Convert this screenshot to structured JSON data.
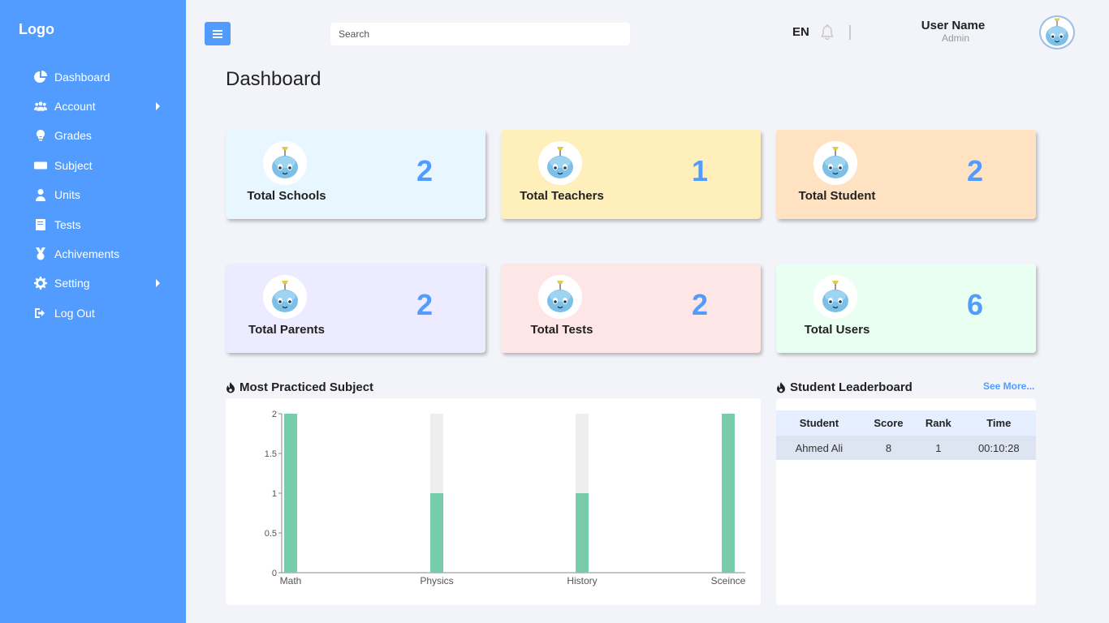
{
  "sidebar": {
    "logo": "Logo",
    "items": [
      {
        "label": "Dashboard",
        "icon": "pie-chart-icon"
      },
      {
        "label": "Account",
        "icon": "users-icon",
        "has_submenu": true
      },
      {
        "label": "Grades",
        "icon": "lightbulb-icon"
      },
      {
        "label": "Subject",
        "icon": "keyboard-icon"
      },
      {
        "label": "Units",
        "icon": "user-icon"
      },
      {
        "label": "Tests",
        "icon": "book-icon"
      },
      {
        "label": "Achivements",
        "icon": "medal-icon"
      },
      {
        "label": "Setting",
        "icon": "gear-icon",
        "has_submenu": true
      },
      {
        "label": "Log Out",
        "icon": "logout-icon"
      }
    ]
  },
  "header": {
    "search_placeholder": "Search",
    "language": "EN",
    "user_name": "User Name",
    "user_role": "Admin"
  },
  "page": {
    "title": "Dashboard"
  },
  "stats": [
    {
      "label": "Total Schools",
      "value": "2",
      "bg": "#e8f7ff"
    },
    {
      "label": "Total Teachers",
      "value": "1",
      "bg": "#ffefbb"
    },
    {
      "label": "Total Student",
      "value": "2",
      "bg": "#ffe2c1"
    },
    {
      "label": "Total Parents",
      "value": "2",
      "bg": "#ecebff"
    },
    {
      "label": "Total Tests",
      "value": "2",
      "bg": "#ffe6e6"
    },
    {
      "label": "Total Users",
      "value": "6",
      "bg": "#e9fff1"
    }
  ],
  "sections": {
    "chart_title": "Most Practiced Subject",
    "leaderboard_title": "Student Leaderboard",
    "see_more": "See More..."
  },
  "leaderboard": {
    "columns": [
      "Student",
      "Score",
      "Rank",
      "Time"
    ],
    "rows": [
      [
        "Ahmed Ali",
        "8",
        "1",
        "00:10:28"
      ]
    ]
  },
  "colors": {
    "accent": "#529cff",
    "bar": "#76ccab",
    "bar_track": "#eeeeee"
  },
  "chart_data": {
    "type": "bar",
    "categories": [
      "Math",
      "Physics",
      "History",
      "Sceince"
    ],
    "values": [
      2,
      1,
      1,
      2
    ],
    "max": 2,
    "ylim": [
      0,
      2
    ],
    "yticks": [
      0,
      0.5,
      1,
      1.5,
      2
    ],
    "ytick_labels": [
      "0",
      "0.5",
      "1",
      "1.5",
      "2"
    ],
    "xlabel": "",
    "ylabel": "",
    "grid": false
  }
}
